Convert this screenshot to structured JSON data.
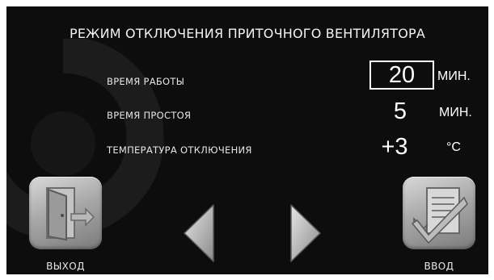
{
  "screen": {
    "title": "РЕЖИМ ОТКЛЮЧЕНИЯ ПРИТОЧНОГО ВЕНТИЛЯТОРА"
  },
  "settings": [
    {
      "label": "ВРЕМЯ  РАБОТЫ",
      "value": "20",
      "unit": "МИН.",
      "selected": true
    },
    {
      "label": "ВРЕМЯ  ПРОСТОЯ",
      "value": "5",
      "unit": "МИН.",
      "selected": false
    },
    {
      "label": "ТЕМПЕРАТУРА ОТКЛЮЧЕНИЯ",
      "value": "+3",
      "unit": "°C",
      "selected": false
    }
  ],
  "buttons": {
    "exit_label": "ВЫХОД",
    "enter_label": "ВВОД"
  },
  "icons": {
    "exit": "door-exit-icon",
    "enter": "checklist-check-icon",
    "prev": "arrow-left-icon",
    "next": "arrow-right-icon"
  },
  "colors": {
    "background": "#0d0d0d",
    "text": "#ffffff",
    "button": "#a9a9a9"
  }
}
